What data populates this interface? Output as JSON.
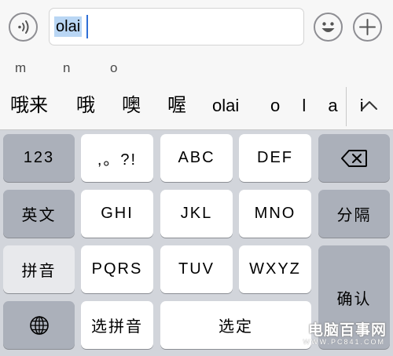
{
  "input_bar": {
    "text_value": "olai",
    "voice_icon": "voice-wave-icon",
    "emoji_icon": "emoji-smile-icon",
    "add_icon": "plus-icon"
  },
  "pinyin_row": {
    "letters": [
      "m",
      "n",
      "o"
    ]
  },
  "candidates": {
    "items": [
      "哦来",
      "哦",
      "噢",
      "喔",
      "olai",
      "o l a i"
    ],
    "expand_icon": "chevron-up-icon"
  },
  "keyboard": {
    "row1": {
      "numbers": "123",
      "punct": ",。?!",
      "abc": "ABC",
      "def": "DEF",
      "backspace_icon": "backspace-icon"
    },
    "row2": {
      "english": "英文",
      "ghi": "GHI",
      "jkl": "JKL",
      "mno": "MNO",
      "separator": "分隔"
    },
    "row3": {
      "pinyin": "拼音",
      "pqrs": "PQRS",
      "tuv": "TUV",
      "wxyz": "WXYZ",
      "confirm": "确认"
    },
    "row4": {
      "globe_icon": "globe-icon",
      "select_pinyin": "选拼音",
      "select": "选定"
    }
  },
  "watermark": {
    "text": "电脑百事网",
    "url": "WWW.PC841.COM"
  },
  "colors": {
    "keyboard_bg": "#d2d5db",
    "function_key": "#abb0ba",
    "letter_key": "#ffffff",
    "selection": "#b9d6f4",
    "caret": "#2f6fd6"
  }
}
